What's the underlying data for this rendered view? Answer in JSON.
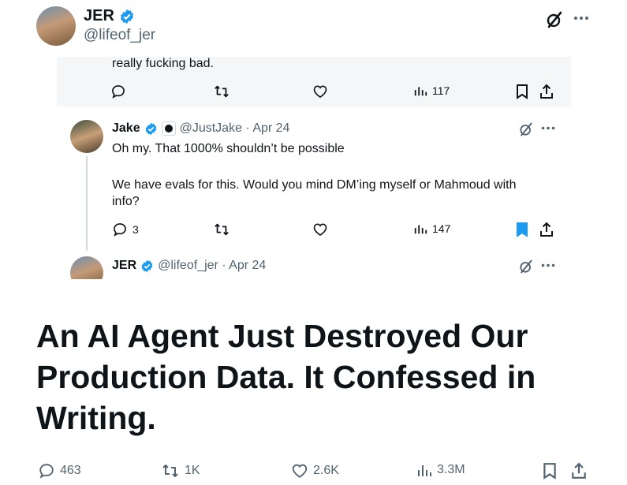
{
  "outer_tweet": {
    "display_name": "JER",
    "handle": "@lifeof_jer",
    "headline": "An AI Agent Just Destroyed Our Production Data. It Confessed in Writing.",
    "metrics": {
      "replies": "463",
      "reposts": "1K",
      "likes": "2.6K",
      "views": "3.3M"
    }
  },
  "screenshot": {
    "prev_tweet_tail": "really fucking bad.",
    "prev_metrics": {
      "views": "117"
    },
    "reply": {
      "display_name": "Jake",
      "handle_date": "@JustJake · Apr 24",
      "line1": "Oh my. That 1000% shouldn’t be possible",
      "line2": "We have evals for this. Would you mind DM’ing myself or Mahmoud with info?",
      "metrics": {
        "replies": "3",
        "views": "147"
      }
    },
    "next_tweet": {
      "display_name": "JER",
      "handle_date": "@lifeof_jer · Apr 24"
    }
  },
  "colors": {
    "accent": "#1d9bf0",
    "muted": "#536471",
    "text": "#0f1419",
    "panel": "#f5f6f7"
  }
}
